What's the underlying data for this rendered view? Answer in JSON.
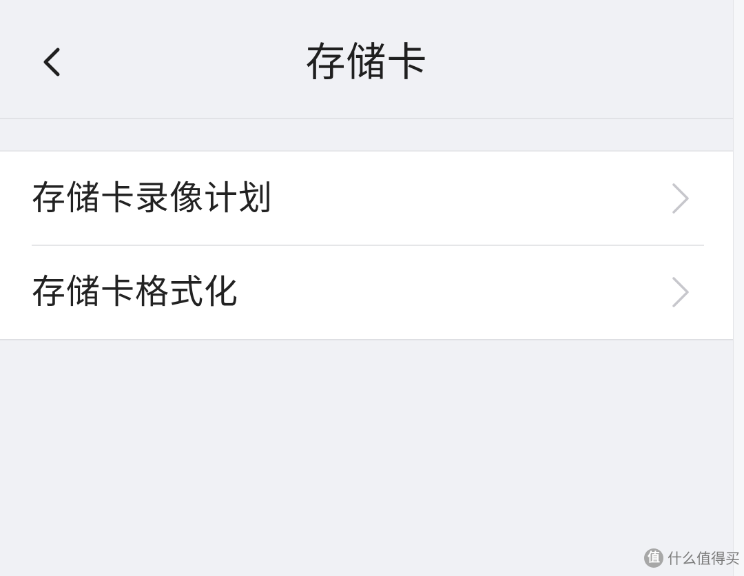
{
  "nav": {
    "title": "存储卡",
    "back_icon": "chevron-left-icon"
  },
  "items": [
    {
      "label": "存储卡录像计划",
      "icon": "chevron-right-icon"
    },
    {
      "label": "存储卡格式化",
      "icon": "chevron-right-icon"
    }
  ],
  "watermark": {
    "logo_glyph": "值",
    "text": "什么值得买"
  },
  "colors": {
    "background": "#f0f1f5",
    "card": "#ffffff",
    "text": "#222222",
    "chevron": "#c7c7cc"
  }
}
